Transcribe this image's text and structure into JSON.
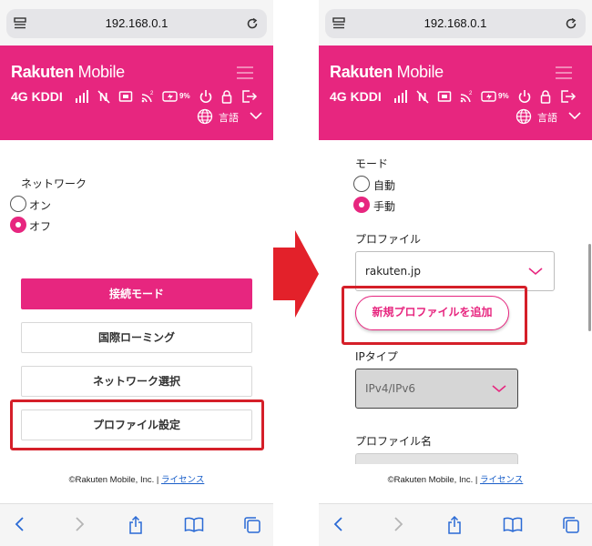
{
  "browser": {
    "url": "192.168.0.1"
  },
  "brand": {
    "bold": "Rakuten",
    "light": " Mobile"
  },
  "status": {
    "network": "4G KDDI",
    "battery": "9%"
  },
  "language": {
    "label": "言語"
  },
  "left": {
    "network_label": "ネットワーク",
    "radio_on": "オン",
    "radio_off": "オフ",
    "buttons": [
      "接続モード",
      "国際ローミング",
      "ネットワーク選択",
      "プロファイル設定"
    ]
  },
  "right": {
    "mode_label": "モード",
    "mode_auto": "自動",
    "mode_manual": "手動",
    "profile_label": "プロファイル",
    "profile_value": "rakuten.jp",
    "add_profile": "新規プロファイルを追加",
    "ip_type_label": "IPタイプ",
    "ip_type_value": "IPv4/IPv6",
    "profile_name_label": "プロファイル名"
  },
  "footer": {
    "copyright": "©Rakuten Mobile, Inc. | ",
    "link": "ライセンス"
  },
  "icons": [
    "tab-icon",
    "reload-icon",
    "hamburger-menu-icon",
    "signal-icon",
    "no-signal-icon",
    "sim-icon",
    "wifi-icon",
    "battery-icon",
    "power-icon",
    "lock-icon",
    "logout-icon",
    "globe-icon",
    "chevron-down-icon",
    "back-icon",
    "forward-icon",
    "share-icon",
    "bookmarks-icon",
    "tabs-icon"
  ],
  "colors": {
    "accent": "#e7267f",
    "highlight": "#d51f29",
    "link": "#1a5fc9"
  }
}
